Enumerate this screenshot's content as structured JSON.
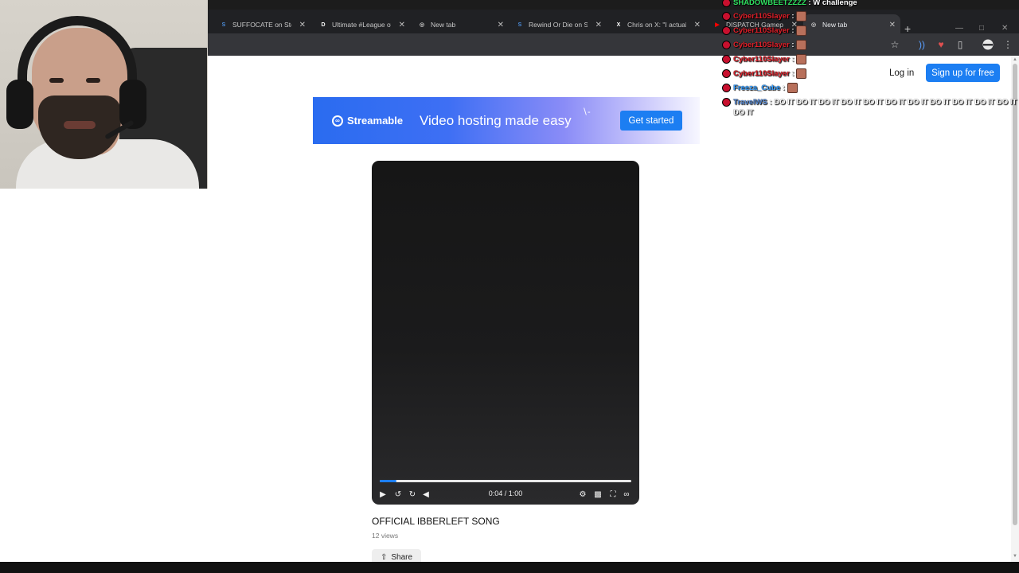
{
  "browser": {
    "tabs": [
      {
        "title": "SUFFOCATE on Steam",
        "favicon": "steam-icon",
        "active": false
      },
      {
        "title": "Ultimate #League of",
        "favicon": "discord-icon",
        "active": false
      },
      {
        "title": "New tab",
        "favicon": "chrome-icon",
        "active": false
      },
      {
        "title": "Rewind Or Die on Ste",
        "favicon": "steam-icon",
        "active": false
      },
      {
        "title": "Chris on X: \"I actually",
        "favicon": "x-icon",
        "active": false
      },
      {
        "title": "DISPATCH Gameplay",
        "favicon": "youtube-icon",
        "active": false
      },
      {
        "title": "New tab",
        "favicon": "chrome-icon",
        "active": true
      }
    ],
    "new_tab": "+",
    "toolbar_icons": [
      "star-icon",
      "extension-audio-icon",
      "extension-heart-icon",
      "puzzle-icon",
      "profile-icon",
      "kebab-menu-icon"
    ]
  },
  "header": {
    "login_label": "Log in",
    "signup_label": "Sign up for free"
  },
  "banner": {
    "brand": "Streamable",
    "tagline": "Video hosting made easy",
    "cta": "Get started"
  },
  "player": {
    "timecode": "0:04 / 1:00",
    "progress": 0.067,
    "controls": [
      "play-icon",
      "rewind-icon",
      "forward-icon",
      "volume-icon",
      "settings-icon",
      "pip-icon",
      "fullscreen-icon",
      "streamable-logo-icon"
    ]
  },
  "video": {
    "title": "OFFICIAL IBBERLEFT SONG",
    "views": "12 views",
    "share_label": "Share"
  },
  "chat": {
    "messages": [
      {
        "user": "SHADOWBEETZZZZ",
        "color": "#30e060",
        "msg": "W challenge",
        "emote": false
      },
      {
        "user": "Cyber110Slayer",
        "color": "#e0202a",
        "msg": "",
        "emote": true
      },
      {
        "user": "Cyber110Slayer",
        "color": "#e0202a",
        "msg": "",
        "emote": true
      },
      {
        "user": "Cyber110Slayer",
        "color": "#e0202a",
        "msg": "",
        "emote": true
      },
      {
        "user": "Cyber110Slayer",
        "color": "#e0202a",
        "msg": "",
        "emote": true
      },
      {
        "user": "Cyber110Slayer",
        "color": "#e0202a",
        "msg": "",
        "emote": true
      },
      {
        "user": "Freeza_Cube",
        "color": "#3aa0ff",
        "msg": "",
        "emote": true
      },
      {
        "user": "TravelWS",
        "color": "#5b8dd6",
        "msg": "DO IT DO IT DO IT DO IT DO IT DO IT DO IT DO IT DO IT DO IT DO IT DO IT",
        "emote": false
      }
    ]
  }
}
